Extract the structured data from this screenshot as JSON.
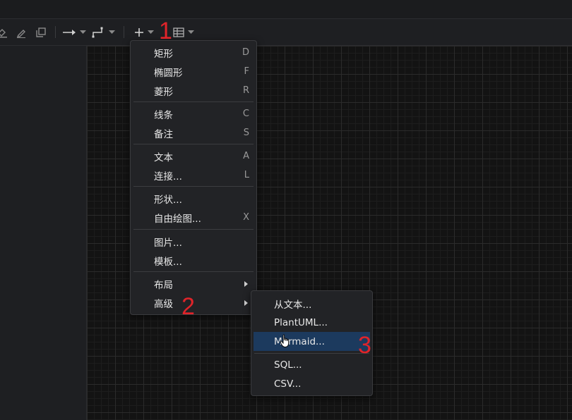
{
  "toolbar": {
    "tools": [
      {
        "icon": "fill-color-icon"
      },
      {
        "icon": "line-color-icon"
      },
      {
        "icon": "shadow-icon"
      },
      {
        "icon": "connection-arrow-icon"
      },
      {
        "icon": "waypoints-icon"
      },
      {
        "icon": "insert-plus-icon"
      },
      {
        "icon": "table-icon"
      }
    ]
  },
  "insert_menu": {
    "groups": [
      [
        {
          "label": "矩形",
          "shortcut": "D"
        },
        {
          "label": "椭圆形",
          "shortcut": "F"
        },
        {
          "label": "菱形",
          "shortcut": "R"
        }
      ],
      [
        {
          "label": "线条",
          "shortcut": "C"
        },
        {
          "label": "备注",
          "shortcut": "S"
        }
      ],
      [
        {
          "label": "文本",
          "shortcut": "A"
        },
        {
          "label": "连接...",
          "shortcut": "L"
        }
      ],
      [
        {
          "label": "形状...",
          "shortcut": ""
        },
        {
          "label": "自由绘图...",
          "shortcut": "X"
        }
      ],
      [
        {
          "label": "图片...",
          "shortcut": ""
        },
        {
          "label": "模板...",
          "shortcut": ""
        }
      ],
      [
        {
          "label": "布局",
          "submenu": true
        },
        {
          "label": "高级",
          "submenu": true
        }
      ]
    ]
  },
  "advanced_submenu": {
    "items": [
      {
        "label": "从文本..."
      },
      {
        "label": "PlantUML..."
      },
      {
        "label": "Mermaid...",
        "highlighted": true
      },
      {
        "label": "SQL..."
      },
      {
        "label": "CSV..."
      }
    ]
  },
  "annotations": [
    "1",
    "2",
    "3"
  ],
  "colors": {
    "background": "#1e1f22",
    "menu_bg": "#222326",
    "highlight": "#1c3a5e",
    "annotation": "#e0242a"
  }
}
